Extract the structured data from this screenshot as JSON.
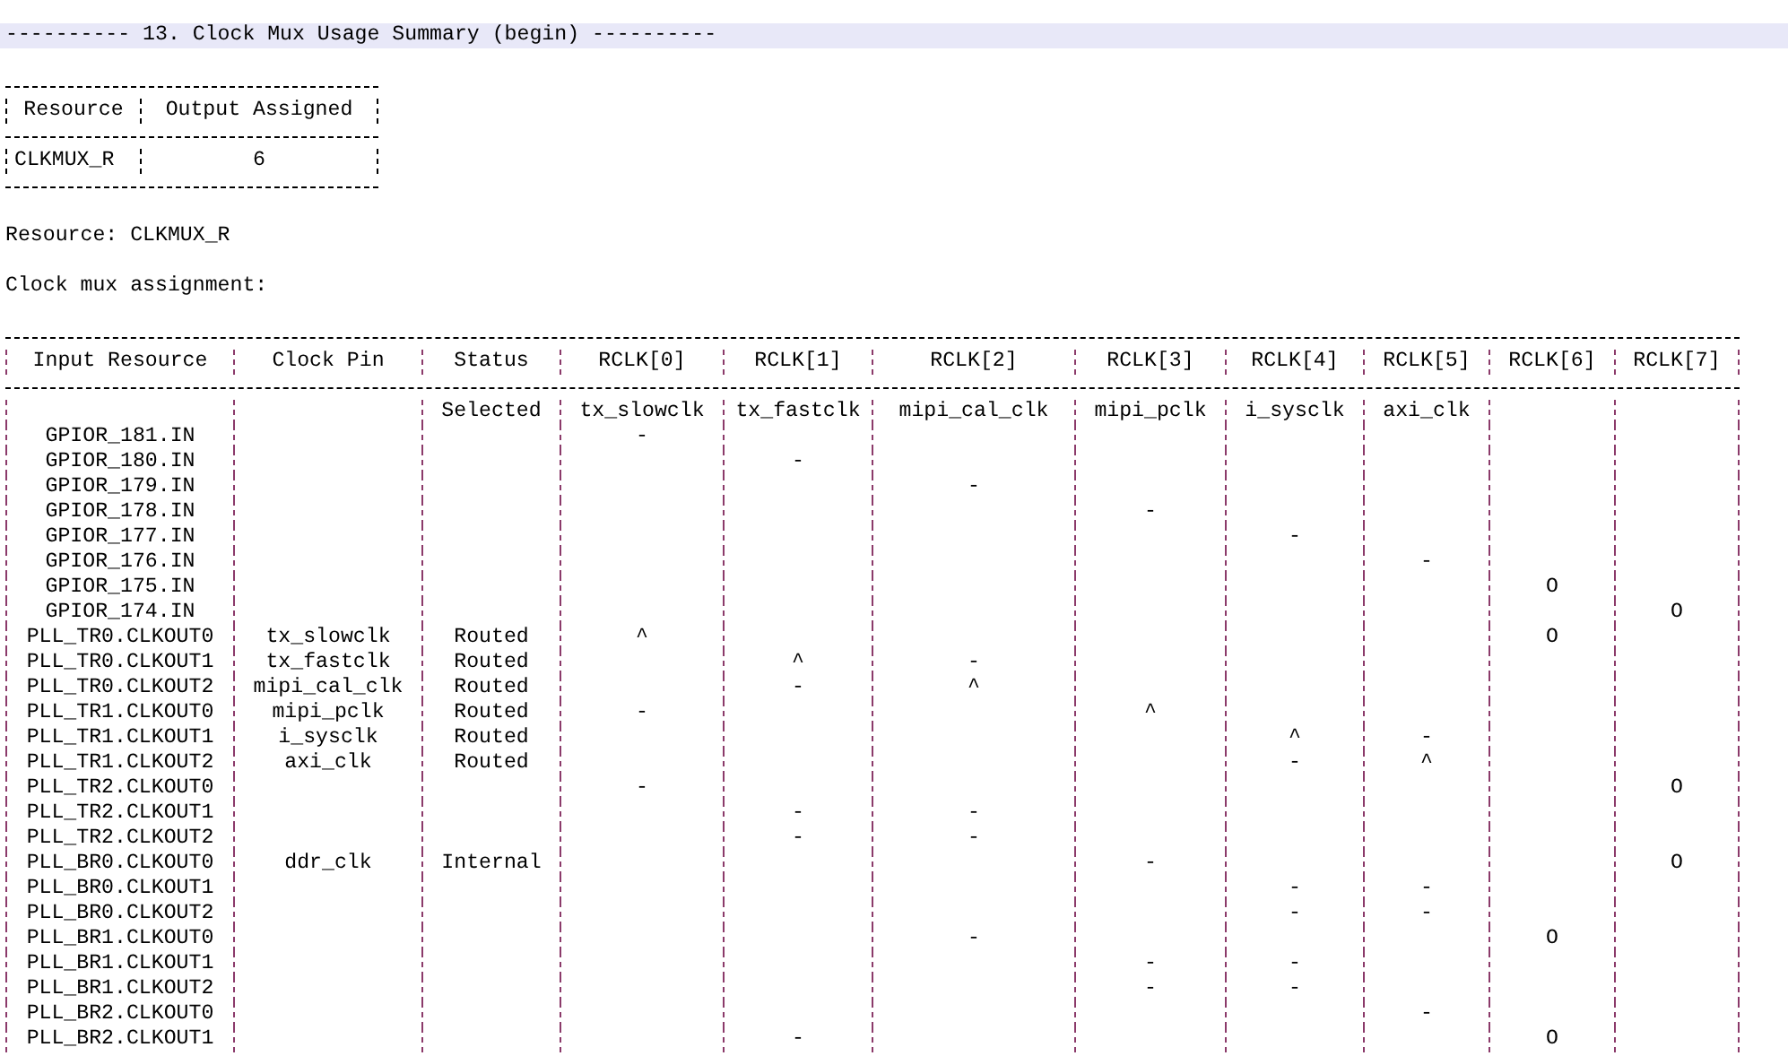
{
  "banner": "---------- 13. Clock Mux Usage Summary (begin) ----------",
  "usage_table": {
    "columns": [
      "Resource",
      "Output Assigned"
    ],
    "rows": [
      [
        "CLKMUX_R",
        "6"
      ]
    ]
  },
  "resource_line": "Resource: CLKMUX_R",
  "assignment_label": "Clock mux assignment:",
  "assignment_table": {
    "columns": [
      "Input Resource",
      "Clock Pin",
      "Status",
      "RCLK[0]",
      "RCLK[1]",
      "RCLK[2]",
      "RCLK[3]",
      "RCLK[4]",
      "RCLK[5]",
      "RCLK[6]",
      "RCLK[7]"
    ],
    "rows": [
      {
        "status": "Selected",
        "rclk_0": "tx_slowclk",
        "rclk_1": "tx_fastclk",
        "rclk_2": "mipi_cal_clk",
        "rclk_3": "mipi_pclk",
        "rclk_4": "i_sysclk",
        "rclk_5": "axi_clk"
      },
      {
        "input_resource": "GPIOR_181.IN",
        "rclk_0": "-"
      },
      {
        "input_resource": "GPIOR_180.IN",
        "rclk_1": "-"
      },
      {
        "input_resource": "GPIOR_179.IN",
        "rclk_2": "-"
      },
      {
        "input_resource": "GPIOR_178.IN",
        "rclk_3": "-"
      },
      {
        "input_resource": "GPIOR_177.IN",
        "rclk_4": "-"
      },
      {
        "input_resource": "GPIOR_176.IN",
        "rclk_5": "-"
      },
      {
        "input_resource": "GPIOR_175.IN",
        "rclk_6": "O"
      },
      {
        "input_resource": "GPIOR_174.IN",
        "rclk_7": "O"
      },
      {
        "input_resource": "PLL_TR0.CLKOUT0",
        "clock_pin": "tx_slowclk",
        "status": "Routed",
        "rclk_0": "^",
        "rclk_6": "O"
      },
      {
        "input_resource": "PLL_TR0.CLKOUT1",
        "clock_pin": "tx_fastclk",
        "status": "Routed",
        "rclk_1": "^",
        "rclk_2": "-"
      },
      {
        "input_resource": "PLL_TR0.CLKOUT2",
        "clock_pin": "mipi_cal_clk",
        "status": "Routed",
        "rclk_1": "-",
        "rclk_2": "^"
      },
      {
        "input_resource": "PLL_TR1.CLKOUT0",
        "clock_pin": "mipi_pclk",
        "status": "Routed",
        "rclk_0": "-",
        "rclk_3": "^"
      },
      {
        "input_resource": "PLL_TR1.CLKOUT1",
        "clock_pin": "i_sysclk",
        "status": "Routed",
        "rclk_4": "^",
        "rclk_5": "-"
      },
      {
        "input_resource": "PLL_TR1.CLKOUT2",
        "clock_pin": "axi_clk",
        "status": "Routed",
        "rclk_4": "-",
        "rclk_5": "^"
      },
      {
        "input_resource": "PLL_TR2.CLKOUT0",
        "rclk_0": "-",
        "rclk_7": "O"
      },
      {
        "input_resource": "PLL_TR2.CLKOUT1",
        "rclk_1": "-",
        "rclk_2": "-"
      },
      {
        "input_resource": "PLL_TR2.CLKOUT2",
        "rclk_1": "-",
        "rclk_2": "-"
      },
      {
        "input_resource": "PLL_BR0.CLKOUT0",
        "clock_pin": "ddr_clk",
        "status": "Internal",
        "rclk_3": "-",
        "rclk_7": "O"
      },
      {
        "input_resource": "PLL_BR0.CLKOUT1",
        "rclk_4": "-",
        "rclk_5": "-"
      },
      {
        "input_resource": "PLL_BR0.CLKOUT2",
        "rclk_4": "-",
        "rclk_5": "-"
      },
      {
        "input_resource": "PLL_BR1.CLKOUT0",
        "rclk_2": "-",
        "rclk_6": "O"
      },
      {
        "input_resource": "PLL_BR1.CLKOUT1",
        "rclk_3": "-",
        "rclk_4": "-"
      },
      {
        "input_resource": "PLL_BR1.CLKOUT2",
        "rclk_3": "-",
        "rclk_4": "-"
      },
      {
        "input_resource": "PLL_BR2.CLKOUT0",
        "rclk_5": "-"
      },
      {
        "input_resource": "PLL_BR2.CLKOUT1",
        "rclk_1": "-",
        "rclk_6": "O"
      }
    ]
  }
}
